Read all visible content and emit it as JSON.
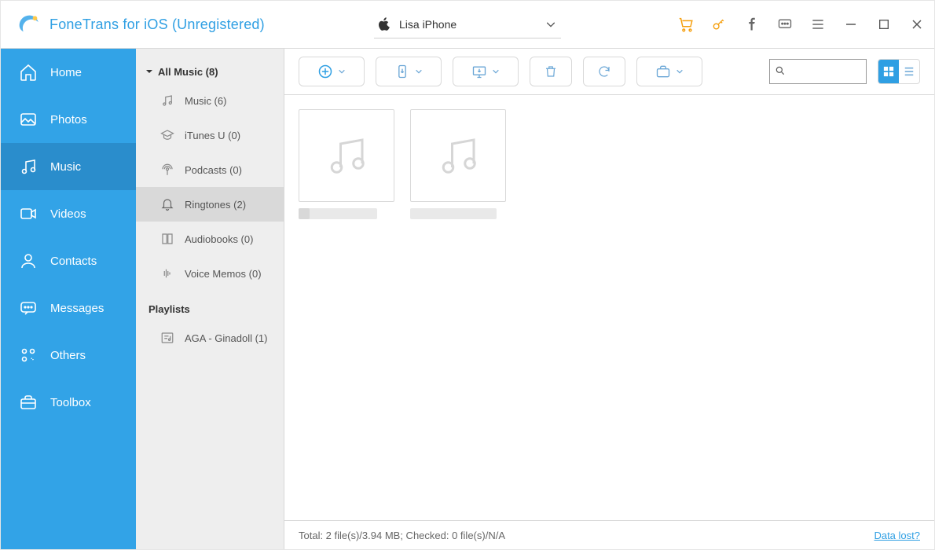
{
  "app": {
    "title": "FoneTrans for iOS (Unregistered)"
  },
  "device": {
    "name": "Lisa iPhone"
  },
  "nav": {
    "items": [
      {
        "label": "Home"
      },
      {
        "label": "Photos"
      },
      {
        "label": "Music"
      },
      {
        "label": "Videos"
      },
      {
        "label": "Contacts"
      },
      {
        "label": "Messages"
      },
      {
        "label": "Others"
      },
      {
        "label": "Toolbox"
      }
    ],
    "selectedIndex": 2
  },
  "categories": {
    "header": "All Music (8)",
    "items": [
      {
        "label": "Music (6)"
      },
      {
        "label": "iTunes U (0)"
      },
      {
        "label": "Podcasts (0)"
      },
      {
        "label": "Ringtones (2)"
      },
      {
        "label": "Audiobooks (0)"
      },
      {
        "label": "Voice Memos (0)"
      }
    ],
    "selectedIndex": 3,
    "playlistsHeader": "Playlists",
    "playlists": [
      {
        "label": "AGA - Ginadoll (1)"
      }
    ]
  },
  "search": {
    "placeholder": ""
  },
  "grid": {
    "items": [
      {
        "title": ""
      },
      {
        "title": ""
      }
    ]
  },
  "status": {
    "text": "Total: 2 file(s)/3.94 MB; Checked: 0 file(s)/N/A",
    "link": "Data lost?"
  }
}
